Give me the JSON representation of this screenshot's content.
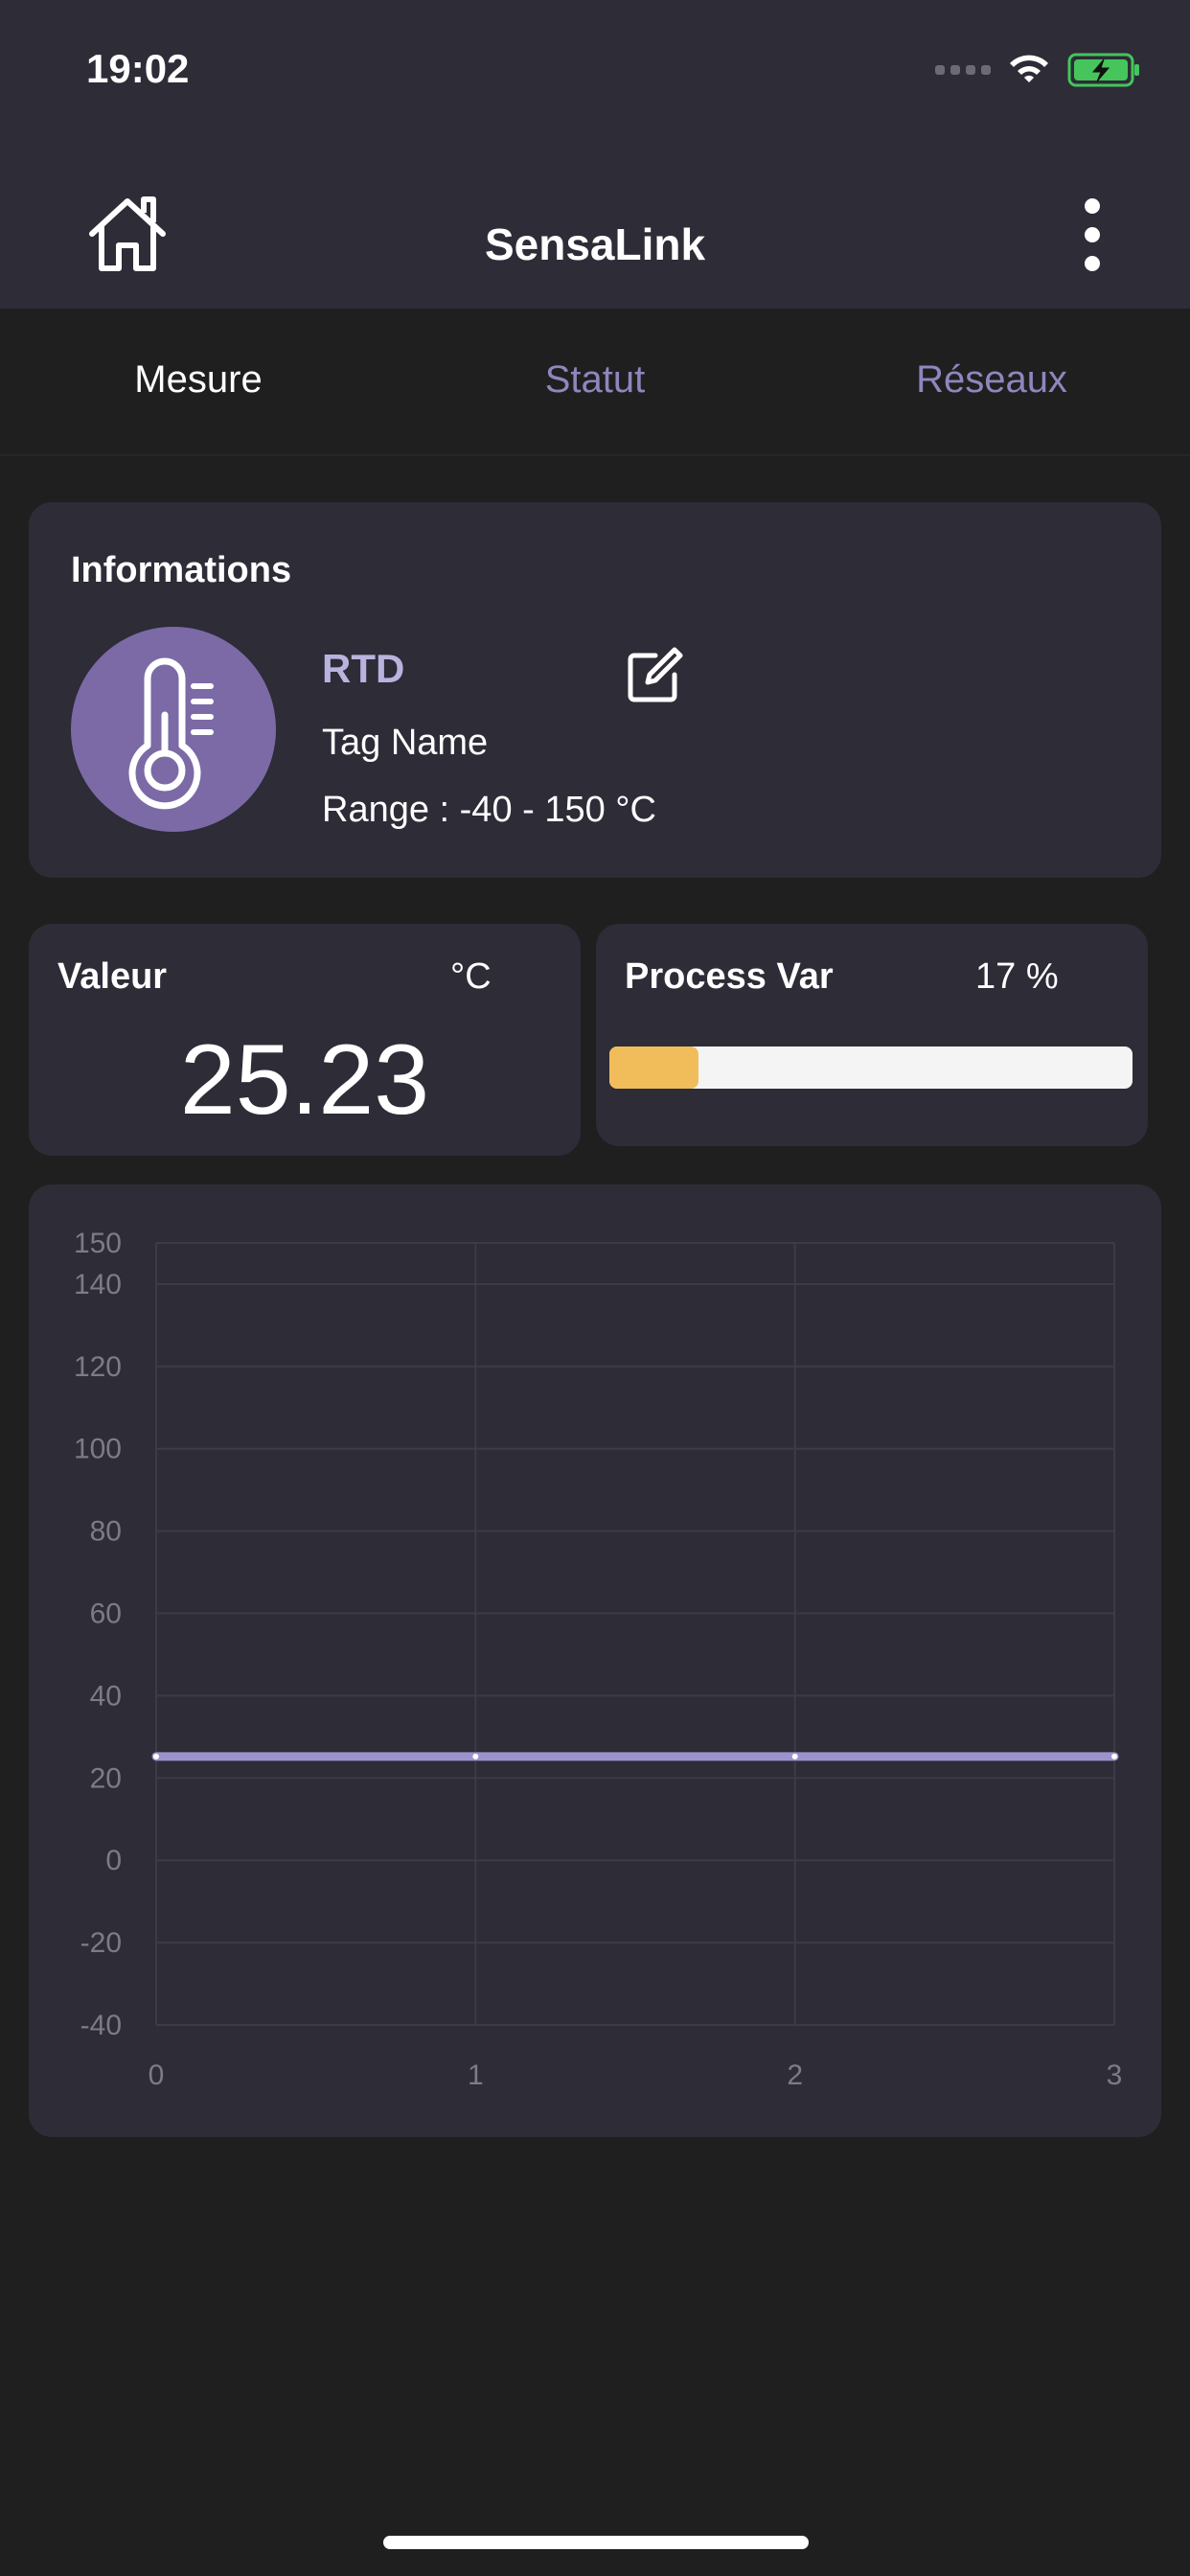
{
  "status_bar": {
    "time": "19:02",
    "battery": "charging"
  },
  "header": {
    "title": "SensaLink",
    "home_icon": "home-icon",
    "menu_icon": "more-vertical-icon"
  },
  "tabs": [
    {
      "label": "Mesure",
      "active": true
    },
    {
      "label": "Statut",
      "active": false
    },
    {
      "label": "Réseaux",
      "active": false
    }
  ],
  "info": {
    "title": "Informations",
    "sensor_type": "RTD",
    "tag_name": "Tag Name",
    "range": "Range : -40 - 150 °C",
    "icon": "thermometer-icon",
    "edit_icon": "edit-icon"
  },
  "valeur": {
    "title": "Valeur",
    "unit": "°C",
    "value": "25.23"
  },
  "process_var": {
    "title": "Process Var",
    "percent_label": "17 %",
    "fraction": 0.17
  },
  "colors": {
    "accent": "#8f86bf",
    "card": "#2d2c37",
    "background": "#1f1f1f",
    "line": "#9d93cc",
    "progress": "#f1bd5a"
  },
  "chart_data": {
    "type": "line",
    "x": [
      0,
      1,
      2,
      3
    ],
    "series": [
      {
        "values": [
          25.23,
          25.23,
          25.23,
          25.23
        ]
      }
    ],
    "y_ticks": [
      150,
      140,
      120,
      100,
      80,
      60,
      40,
      20,
      0,
      -20,
      -40
    ],
    "x_ticks": [
      0,
      1,
      2,
      3
    ],
    "xlim": [
      0,
      3
    ],
    "ylim": [
      -40,
      150
    ],
    "grid": true
  }
}
